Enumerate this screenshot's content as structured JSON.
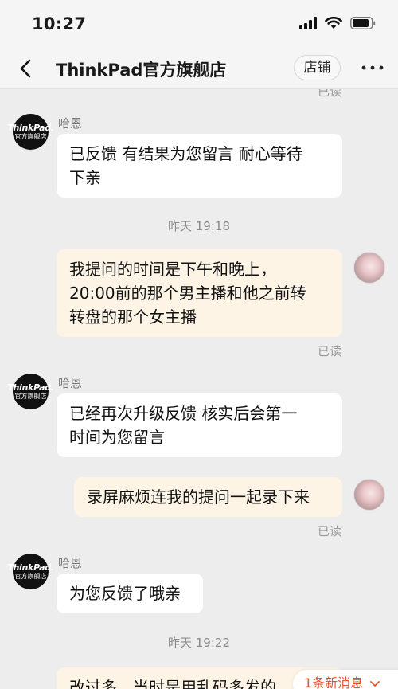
{
  "status_bar": {
    "time": "10:27"
  },
  "nav": {
    "title": "ThinkPad官方旗舰店",
    "store_button": "店铺"
  },
  "store_avatar": {
    "brand": "ThinkPad.",
    "sub": "官方旗舰店"
  },
  "messages": [
    {
      "type": "read",
      "text": "已读"
    },
    {
      "type": "in",
      "sender": "哈恩",
      "lines": [
        "已反馈 有结果为您留言 耐心等待",
        "下亲"
      ]
    },
    {
      "type": "time",
      "text": "昨天 19:18"
    },
    {
      "type": "out",
      "lines": [
        "我提问的时间是下午和晚上，",
        "20:00前的那个男主播和他之前转",
        "转盘的那个女主播"
      ],
      "read": "已读"
    },
    {
      "type": "in",
      "sender": "哈恩",
      "lines": [
        "已经再次升级反馈 核实后会第一",
        "时间为您留言"
      ]
    },
    {
      "type": "out",
      "lines": [
        "录屏麻烦连我的提问一起录下来"
      ],
      "read": "已读"
    },
    {
      "type": "in",
      "sender": "哈恩",
      "lines": [
        "为您反馈了哦亲"
      ]
    },
    {
      "type": "time",
      "text": "昨天 19:22"
    },
    {
      "type": "out_partial",
      "lines": [
        "改过多，当时是用乱码多发的"
      ]
    }
  ],
  "new_message_pill": {
    "text": "1条新消息",
    "icon": "chevron-down-icon"
  }
}
